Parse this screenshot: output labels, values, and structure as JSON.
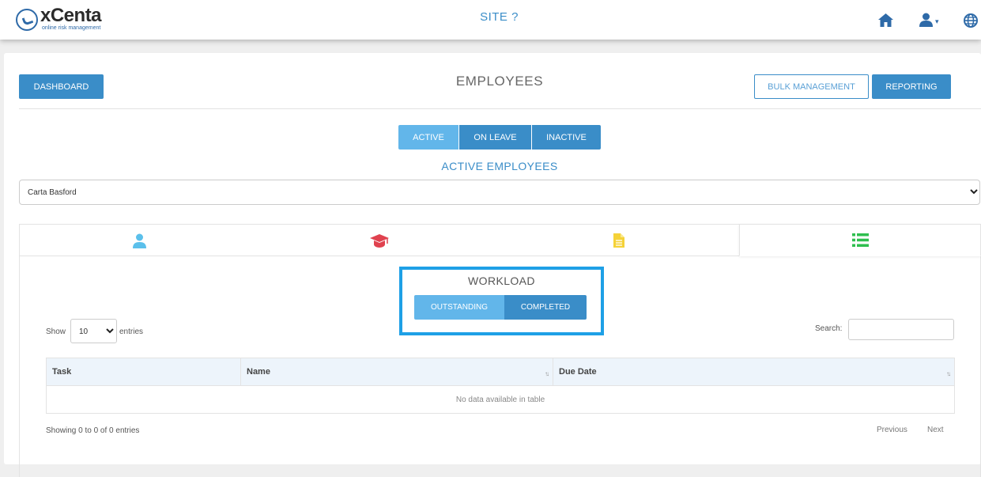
{
  "header": {
    "brand_name": "xCenta",
    "brand_tagline": "online risk management",
    "site_title": "SITE ?",
    "icons": [
      "home-icon",
      "user-icon",
      "globe-icon"
    ]
  },
  "toolbar": {
    "dashboard_label": "DASHBOARD",
    "page_title": "EMPLOYEES",
    "bulk_label": "BULK MANAGEMENT",
    "reporting_label": "REPORTING"
  },
  "status_tabs": {
    "active": "ACTIVE",
    "on_leave": "ON LEAVE",
    "inactive": "INACTIVE",
    "selected": "ACTIVE"
  },
  "section_title": "ACTIVE EMPLOYEES",
  "employee_select": {
    "value": "Carta Basford"
  },
  "detail_tabs": [
    {
      "icon": "user-icon",
      "color": "#5bc0eb"
    },
    {
      "icon": "graduation-cap-icon",
      "color": "#e0424f"
    },
    {
      "icon": "document-icon",
      "color": "#f5d238"
    },
    {
      "icon": "list-icon",
      "color": "#2fbf4f",
      "selected": true
    }
  ],
  "workload": {
    "title": "WORKLOAD",
    "outstanding_label": "OUTSTANDING",
    "completed_label": "COMPLETED"
  },
  "table_controls": {
    "show_label": "Show",
    "page_size": "10",
    "entries_label": "entries",
    "search_label": "Search:",
    "search_value": ""
  },
  "table": {
    "columns": [
      "Task",
      "Name",
      "Due Date"
    ],
    "empty_message": "No data available in table",
    "info": "Showing 0 to 0 of 0 entries",
    "previous_label": "Previous",
    "next_label": "Next"
  },
  "colors": {
    "primary": "#3a8dc8",
    "light_primary": "#62b6ea",
    "highlight_border": "#1ea0e6"
  }
}
